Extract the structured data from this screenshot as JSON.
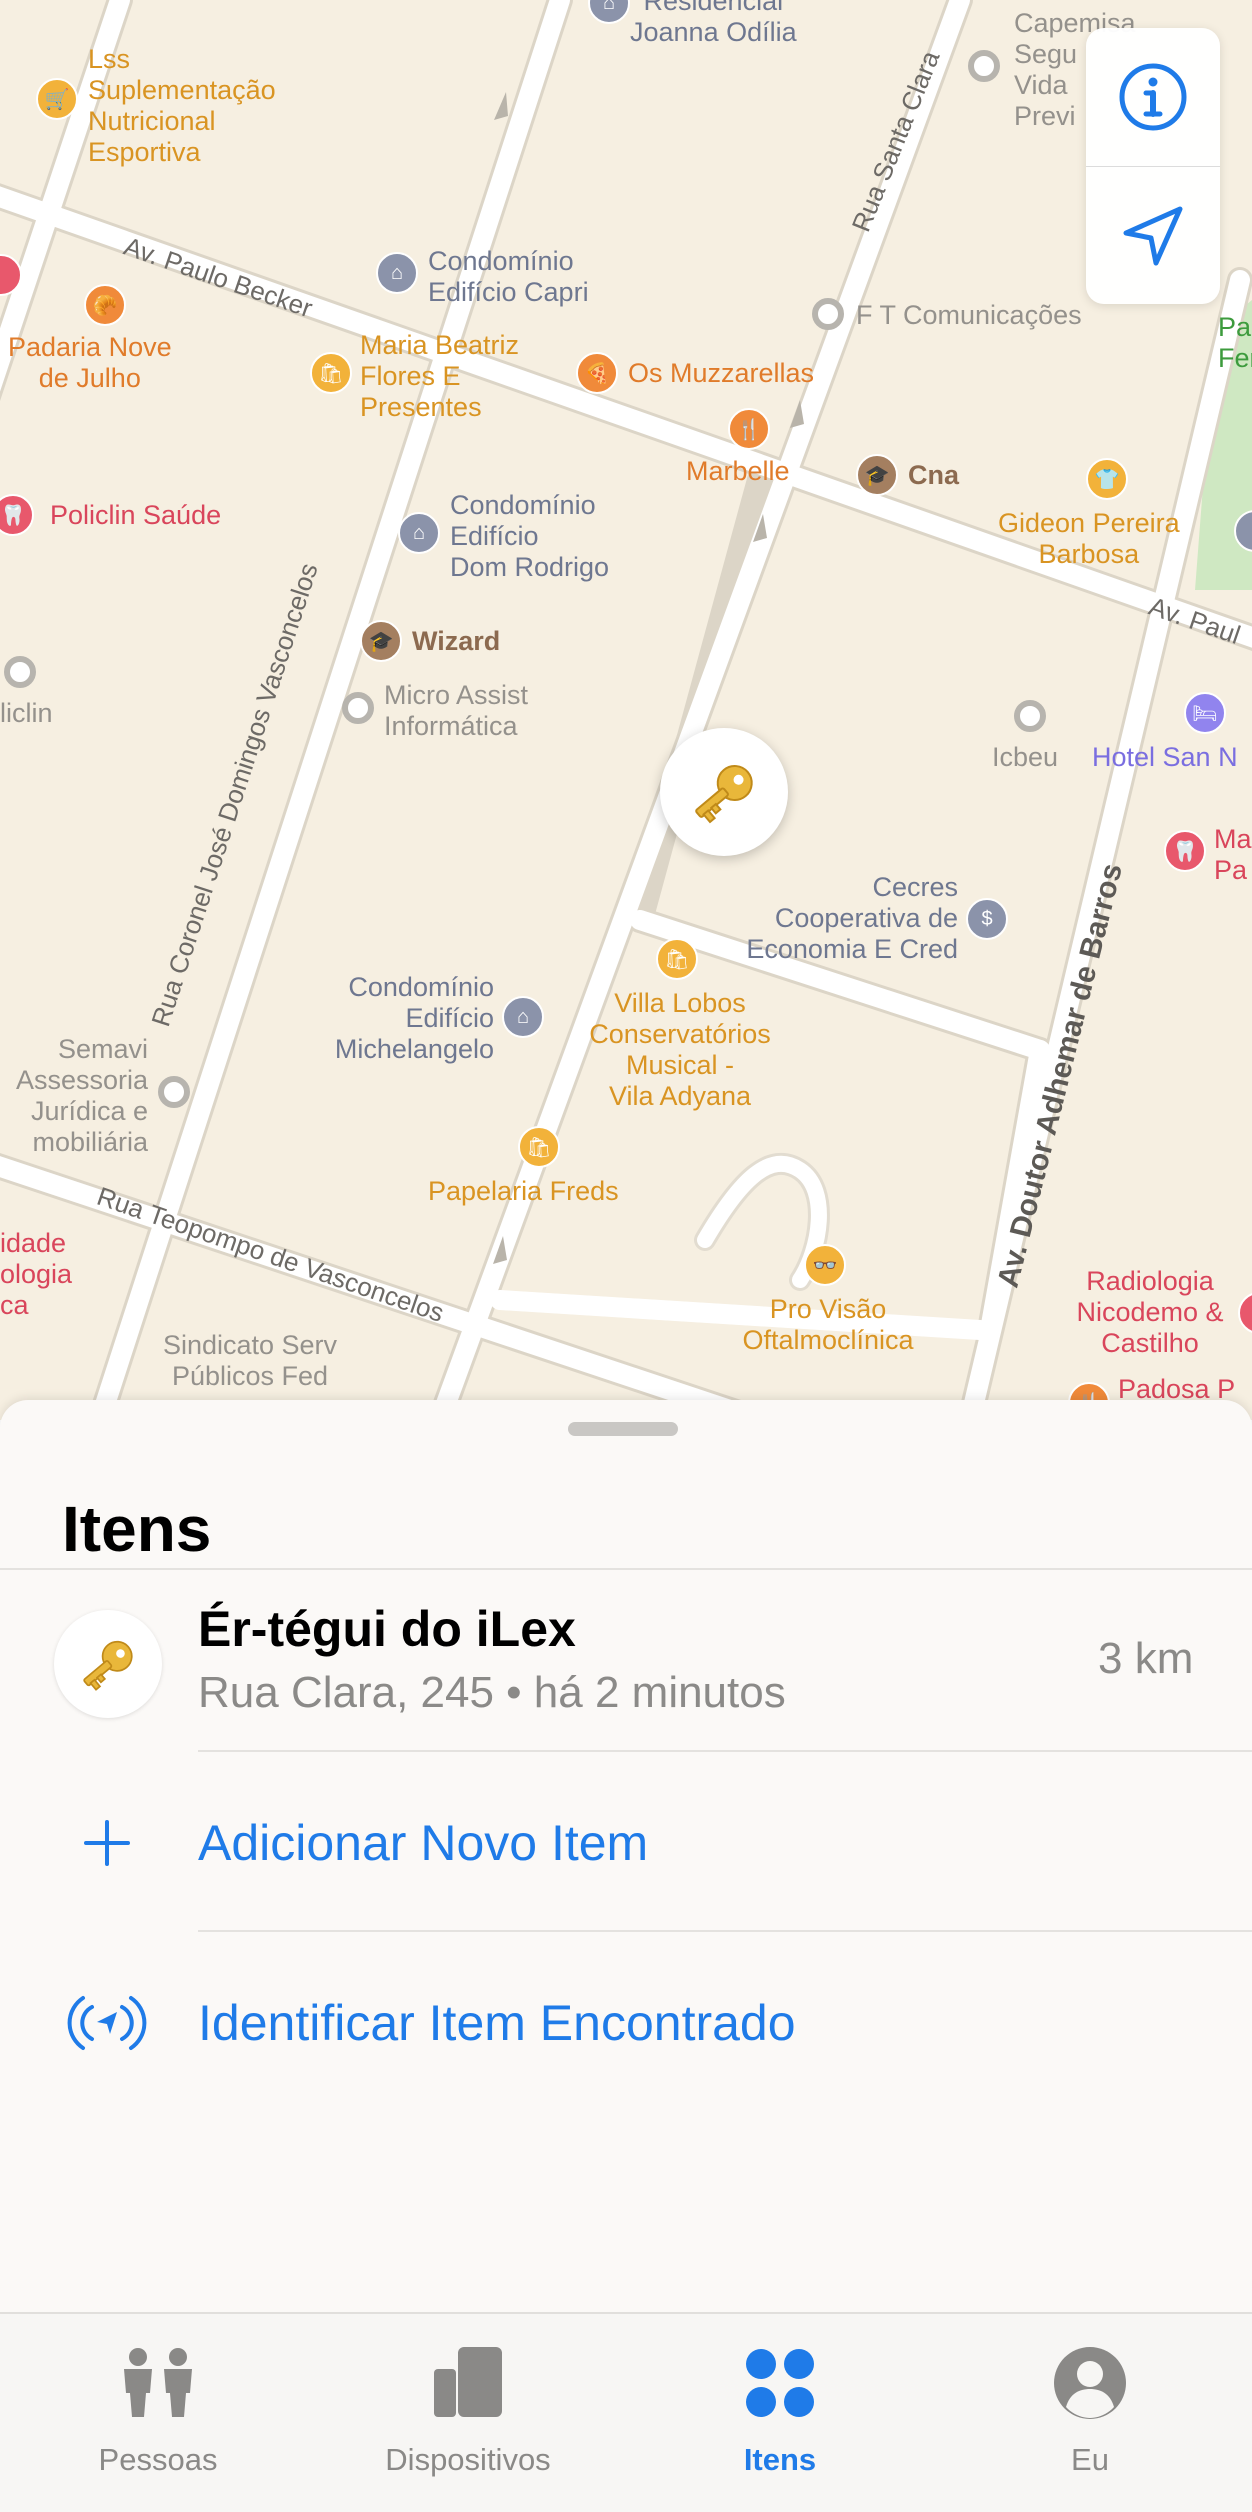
{
  "map": {
    "places": [
      {
        "name": "Lss\nSuplementação\nNutricional\nEsportiva",
        "color": "#d99422",
        "icon": "cart-icon"
      },
      {
        "name": "Residencial\nJoanna Odília",
        "color": "#6e7790",
        "icon": "building-icon"
      },
      {
        "name": "Capemisa\nSegu\nVida\nPrevi",
        "color": "#94918c",
        "icon": "dot-icon"
      },
      {
        "name": "Condomínio\nEdifício Capri",
        "color": "#6e7790",
        "icon": "building-icon"
      },
      {
        "name": "Padaria Nove\nde Julho",
        "color": "#e07b2a",
        "icon": "bakery-icon"
      },
      {
        "name": "Maria Beatriz\nFlores E\nPresentes",
        "color": "#d99422",
        "icon": "bag-icon"
      },
      {
        "name": "Os Muzzarellas",
        "color": "#e07b2a",
        "icon": "pizza-icon"
      },
      {
        "name": "F T Comunicações",
        "color": "#94918c",
        "icon": "dot-icon"
      },
      {
        "name": "Marbelle",
        "color": "#e07b2a",
        "icon": "fork-icon"
      },
      {
        "name": "Cna",
        "color": "#8c6a4f",
        "icon": "school-icon"
      },
      {
        "name": "Gideon Pereira\nBarbosa",
        "color": "#d99422",
        "icon": "shirt-icon"
      },
      {
        "name": "Policlin Saúde",
        "color": "#d9455b",
        "icon": "tooth-icon"
      },
      {
        "name": "Condomínio\nEdifício\nDom Rodrigo",
        "color": "#6e7790",
        "icon": "building-icon"
      },
      {
        "name": "Wizard",
        "color": "#8c6a4f",
        "icon": "school-icon"
      },
      {
        "name": "Micro Assist\nInformática",
        "color": "#94918c",
        "icon": "dot-icon"
      },
      {
        "name": "liclin",
        "color": "#94918c",
        "icon": "dot-icon"
      },
      {
        "name": "Icbeu",
        "color": "#94918c",
        "icon": "dot-icon"
      },
      {
        "name": "Hotel San N",
        "color": "#7a6ee0",
        "icon": "bed-icon"
      },
      {
        "name": "Cecres\nCooperativa de\nEconomia E Cred",
        "color": "#6e7790",
        "icon": "bank-icon"
      },
      {
        "name": "Villa Lobos\nConservatórios\nMusical -\nVila Adyana",
        "color": "#d99422",
        "icon": "bag-icon"
      },
      {
        "name": "Condomínio\nEdifício\nMichelangelo",
        "color": "#6e7790",
        "icon": "building-icon"
      },
      {
        "name": "Semavi\nAssessoria\nJurídica e\nmobiliária",
        "color": "#94918c",
        "icon": "dot-icon"
      },
      {
        "name": "Papelaria Freds",
        "color": "#d99422",
        "icon": "bag-icon"
      },
      {
        "name": "Pro Visão\nOftalmoclínica",
        "color": "#d99422",
        "icon": "glasses-icon"
      },
      {
        "name": "Radiologia\nNicodemo &\nCastilho",
        "color": "#d9455b",
        "icon": "tooth-icon"
      },
      {
        "name": "Padosa P",
        "color": "#d9455b",
        "icon": "fork-icon"
      },
      {
        "name": "Sindicato Serv\nPúblicos Fed",
        "color": "#94918c",
        "icon": "dot-icon"
      },
      {
        "name": "idade\nologia\nca",
        "color": "#d9455b",
        "icon": "none"
      },
      {
        "name": "Ma\nPa",
        "color": "#d9455b",
        "icon": "tooth-icon"
      },
      {
        "name": "Pa\nFer",
        "color": "#3d9b3d",
        "icon": "none"
      }
    ],
    "streets": [
      "Av. Paulo Becker",
      "Rua Santa Clara",
      "Rua Coronel José Domingos Vasconcelos",
      "Av. Doutor Adhemar de Barros",
      "Rua Teopompo de Vasconcelos",
      "Av. Paul"
    ],
    "controls": {
      "info_icon": "info-icon",
      "location_icon": "location-arrow-icon"
    },
    "marker_icon": "key-icon"
  },
  "sheet": {
    "title": "Itens",
    "item": {
      "name": "Ér-tégui do iLex",
      "address": "Rua Clara, 245 • há 2 minutos",
      "distance": "3 km",
      "icon": "key-icon"
    },
    "actions": [
      {
        "label": "Adicionar Novo Item",
        "icon": "plus-icon"
      },
      {
        "label": "Identificar Item Encontrado",
        "icon": "found-item-icon"
      }
    ]
  },
  "tabbar": {
    "tabs": [
      {
        "label": "Pessoas",
        "icon": "people-icon",
        "active": false
      },
      {
        "label": "Dispositivos",
        "icon": "devices-icon",
        "active": false
      },
      {
        "label": "Itens",
        "icon": "items-icon",
        "active": true
      },
      {
        "label": "Eu",
        "icon": "person-icon",
        "active": false
      }
    ]
  },
  "colors": {
    "accent": "#1f7be8",
    "map_bg": "#f6efe1",
    "sheet_bg": "#fbf9f7"
  }
}
